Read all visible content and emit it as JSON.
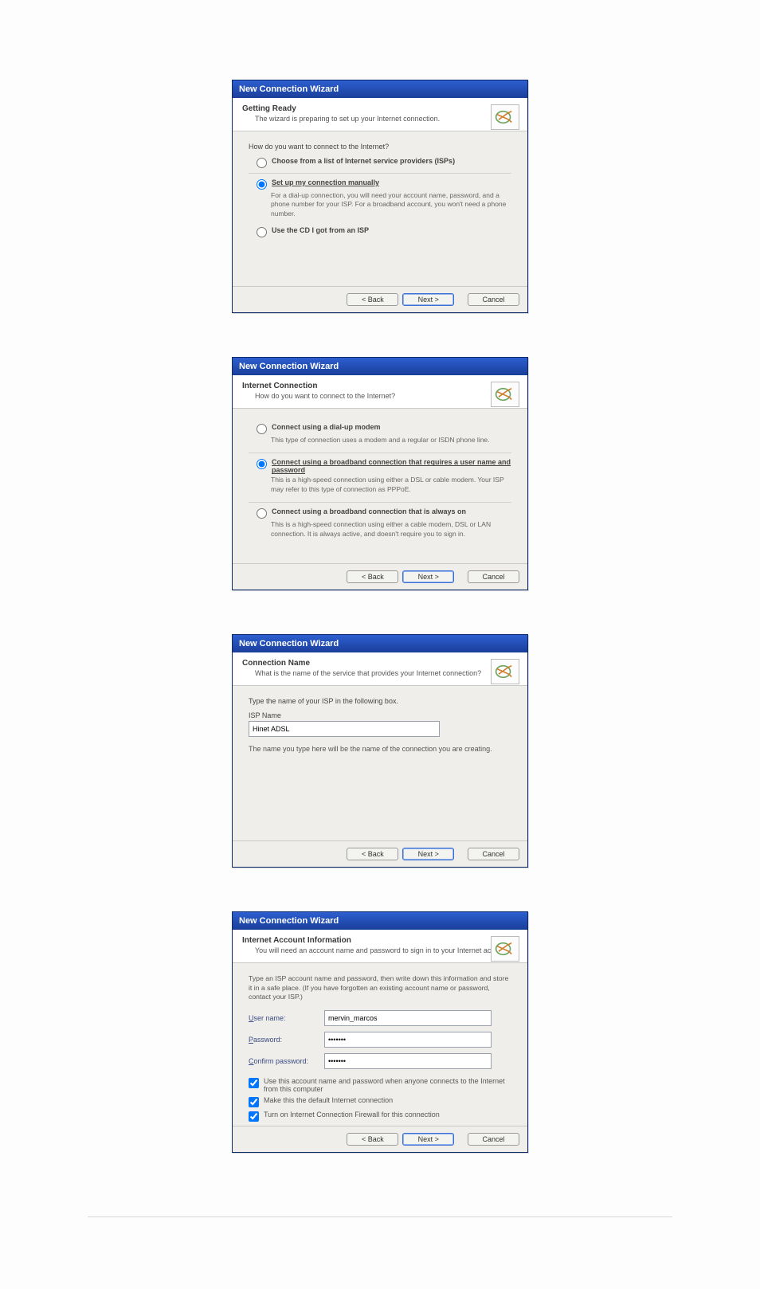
{
  "buttons": {
    "back": "< Back",
    "next": "Next >",
    "cancel": "Cancel"
  },
  "wiz1": {
    "window_title": "New Connection Wizard",
    "header_title": "Getting Ready",
    "header_sub": "The wizard is preparing to set up your Internet connection.",
    "question": "How do you want to connect to the Internet?",
    "opt1": "Choose from a list of Internet service providers (ISPs)",
    "opt2": "Set up my connection manually",
    "opt2_desc": "For a dial-up connection, you will need your account name, password, and a phone number for your ISP. For a broadband account, you won't need a phone number.",
    "opt3": "Use the CD I got from an ISP"
  },
  "wiz2": {
    "window_title": "New Connection Wizard",
    "header_title": "Internet Connection",
    "header_sub": "How do you want to connect to the Internet?",
    "opt1": "Connect using a dial-up modem",
    "opt1_desc": "This type of connection uses a modem and a regular or ISDN phone line.",
    "opt2": "Connect using a broadband connection that requires a user name and password",
    "opt2_desc": "This is a high-speed connection using either a DSL or cable modem. Your ISP may refer to this type of connection as PPPoE.",
    "opt3": "Connect using a broadband connection that is always on",
    "opt3_desc": "This is a high-speed connection using either a cable modem, DSL or LAN connection. It is always active, and doesn't require you to sign in."
  },
  "wiz3": {
    "window_title": "New Connection Wizard",
    "header_title": "Connection Name",
    "header_sub": "What is the name of the service that provides your Internet connection?",
    "prompt": "Type the name of your ISP in the following box.",
    "field_label": "ISP Name",
    "isp_value": "Hinet ADSL",
    "note": "The name you type here will be the name of the connection you are creating."
  },
  "wiz4": {
    "window_title": "New Connection Wizard",
    "header_title": "Internet Account Information",
    "header_sub": "You will need an account name and password to sign in to your Internet account.",
    "intro": "Type an ISP account name and password, then write down this information and store it in a safe place. (If you have forgotten an existing account name or password, contact your ISP.)",
    "user_label": "User name:",
    "user_value": "mervin_marcos",
    "pass_label": "Password:",
    "pass_value": "•••••••",
    "confirm_label": "Confirm password:",
    "confirm_value": "•••••••",
    "chk1": "Use this account name and password when anyone connects to the Internet from this computer",
    "chk2": "Make this the default Internet connection",
    "chk3": "Turn on Internet Connection Firewall for this connection"
  }
}
